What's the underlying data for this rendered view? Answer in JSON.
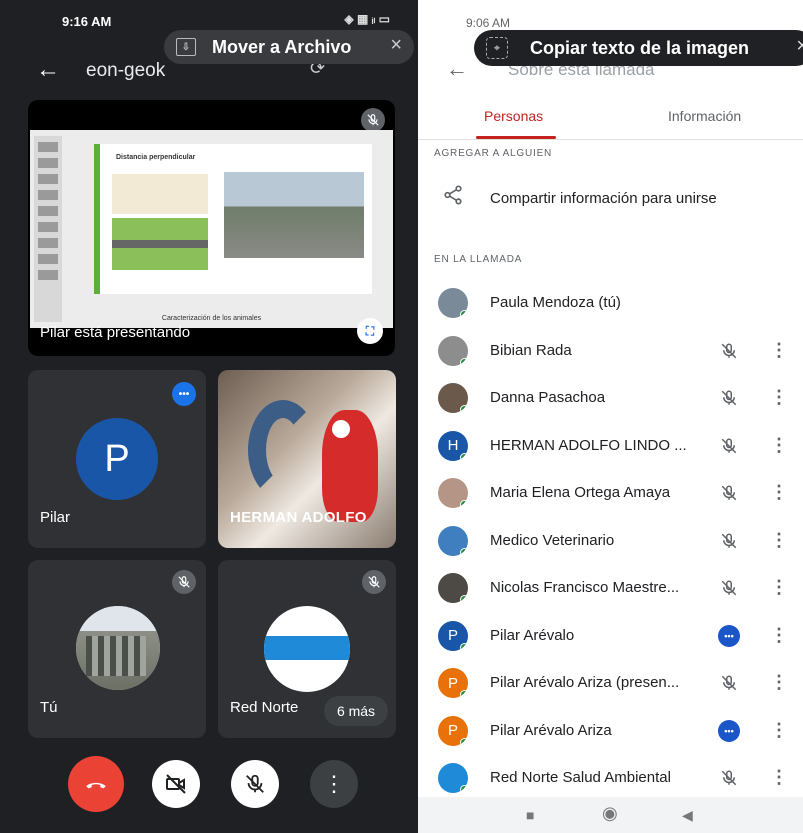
{
  "left": {
    "status_time": "9:16 AM",
    "status_icons": "◈ ▦ ᵢₗ ▭",
    "toast": {
      "text": "Mover a Archivo",
      "close": "×"
    },
    "meeting_title": "eon-geok",
    "presentation_label": "Pilar  está presentando",
    "slide": {
      "title": "Distancia perpendicular",
      "caption": "Caracterización de los animales"
    },
    "tiles": [
      {
        "name": "Pilar",
        "initial": "P"
      },
      {
        "name": "HERMAN ADOLFO"
      },
      {
        "name": "Tú"
      },
      {
        "name": "Red Norte",
        "more": "6 más"
      }
    ]
  },
  "right": {
    "status_time": "9:06 AM",
    "title": "Sobre esta llamada",
    "toast": {
      "text": "Copiar texto de la imagen",
      "close": "×"
    },
    "tabs": [
      {
        "label": "Personas"
      },
      {
        "label": "Información"
      }
    ],
    "add_section": "AGREGAR A ALGUIEN",
    "share_label": "Compartir información para unirse",
    "in_call_section": "EN LA LLAMADA",
    "participants": [
      {
        "name": "Paula Mendoza (tú)",
        "avatar": "photo",
        "color": "#7b8a99",
        "status": "none"
      },
      {
        "name": "Bibian Rada",
        "avatar": "photo",
        "color": "#8d8d8d",
        "status": "muted"
      },
      {
        "name": "Danna Pasachoa",
        "avatar": "photo",
        "color": "#6b5a4c",
        "status": "muted"
      },
      {
        "name": "HERMAN ADOLFO LINDO ...",
        "avatar": "letter",
        "initial": "H",
        "color": "#1a56a8",
        "status": "muted"
      },
      {
        "name": "Maria Elena Ortega Amaya",
        "avatar": "photo",
        "color": "#b59585",
        "status": "muted"
      },
      {
        "name": "Medico Veterinario",
        "avatar": "photo",
        "color": "#3f7fbf",
        "status": "muted"
      },
      {
        "name": "Nicolas Francisco Maestre...",
        "avatar": "photo",
        "color": "#4d4a45",
        "status": "muted"
      },
      {
        "name": "Pilar Arévalo",
        "avatar": "letter",
        "initial": "P",
        "color": "#1a56a8",
        "status": "speaking"
      },
      {
        "name": "Pilar Arévalo Ariza (presen...",
        "avatar": "letter",
        "initial": "P",
        "color": "#e8710a",
        "status": "muted"
      },
      {
        "name": "Pilar Arévalo Ariza",
        "avatar": "letter",
        "initial": "P",
        "color": "#e8710a",
        "status": "speaking"
      },
      {
        "name": "Red Norte Salud Ambiental",
        "avatar": "photo",
        "color": "#1f8ad8",
        "status": "muted"
      }
    ]
  }
}
